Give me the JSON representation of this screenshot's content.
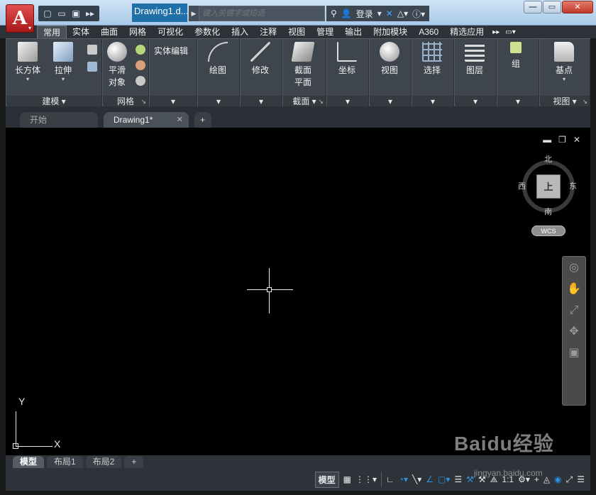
{
  "titlebar": {
    "app_letter": "A",
    "doc_title": "Drawing1.d...",
    "search_placeholder": "键入关键字或短语",
    "login_label": "登录",
    "qat_icons": [
      "new-file-icon",
      "open-folder-icon",
      "save-icon",
      "more-icon"
    ]
  },
  "ribbon_tabs": [
    "常用",
    "实体",
    "曲面",
    "网格",
    "可视化",
    "参数化",
    "插入",
    "注释",
    "视图",
    "管理",
    "输出",
    "附加模块",
    "A360",
    "精选应用"
  ],
  "ribbon": {
    "modeling": {
      "footer": "建模",
      "box": "长方体",
      "extrude": "拉伸"
    },
    "mesh": {
      "footer": "网格",
      "smooth_line1": "平滑",
      "smooth_line2": "对象"
    },
    "solid_edit": {
      "label": "实体编辑"
    },
    "draw": {
      "label": "绘图"
    },
    "modify": {
      "label": "修改"
    },
    "section": {
      "footer": "截面",
      "label_line1": "截面",
      "label_line2": "平面"
    },
    "coords": {
      "label": "坐标"
    },
    "view": {
      "label": "视图"
    },
    "select": {
      "label": "选择"
    },
    "layers": {
      "label": "图层"
    },
    "group": {
      "label": "组"
    },
    "basepoint": {
      "footer": "视图",
      "label": "基点"
    }
  },
  "doc_tabs": {
    "start": "开始",
    "drawing": "Drawing1*",
    "add": "+"
  },
  "viewcube": {
    "north": "北",
    "south": "南",
    "east": "东",
    "west": "西",
    "face": "上",
    "wcs": "WCS"
  },
  "ucs": {
    "x": "X",
    "y": "Y"
  },
  "layout_tabs": [
    "模型",
    "布局1",
    "布局2",
    "+"
  ],
  "statusbar": {
    "model": "模型",
    "scale": "1:1",
    "watermark": "Baidu经验",
    "watermark_url": "jingyan.baidu.com"
  },
  "colors": {
    "accent": "#1f6fa8",
    "app_red": "#c0392b",
    "canvas": "#000000",
    "ribbon": "#3f454d"
  }
}
